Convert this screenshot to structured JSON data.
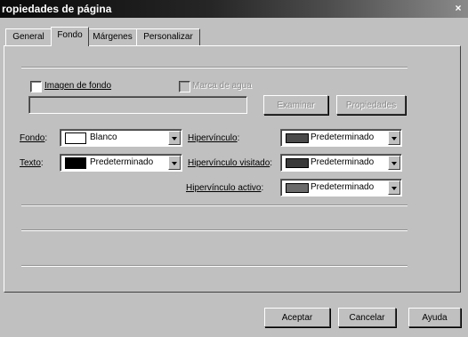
{
  "window": {
    "title": "ropiedades de página",
    "close_glyph": "×"
  },
  "tabs": [
    {
      "label": "General"
    },
    {
      "label": "Fondo"
    },
    {
      "label": "Márgenes"
    },
    {
      "label": "Personalizar"
    }
  ],
  "background_image": {
    "checkbox_label": "Imagen de fondo",
    "lock_label": "Marca de agua",
    "path_value": "",
    "browse_label": "Examinar",
    "properties_label": "Propiedades"
  },
  "colors": {
    "fondo_label": "Fondo",
    "fondo_value": "Blanco",
    "fondo_swatch": "#ffffff",
    "texto_label": "Texto",
    "texto_value": "Predeterminado",
    "texto_swatch": "#000000",
    "hyperlink_label": "Hipervínculo",
    "hyperlink_value": "Predeterminado",
    "hyperlink_swatch": "#4a4a4a",
    "visited_label": "Hipervínculo visitado",
    "visited_value": "Predeterminado",
    "visited_swatch": "#3a3a3a",
    "active_label": "Hipervínculo activo",
    "active_value": "Predeterminado",
    "active_swatch": "#6a6a6a"
  },
  "footer": {
    "accept_label": "Aceptar",
    "cancel_label": "Cancelar",
    "help_label": "Ayuda"
  }
}
